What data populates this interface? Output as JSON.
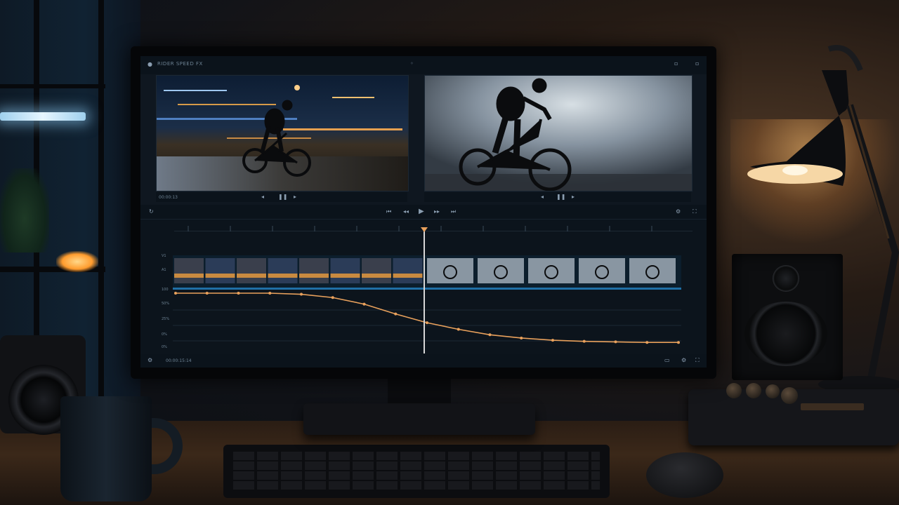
{
  "scene": {
    "type": "photo",
    "subject": "dark desk with monitor running a video editing application"
  },
  "app": {
    "title_text": "RIDER SPEED FX",
    "colors": {
      "accent_blue": "#1f6fa6",
      "curve": "#e9a15c",
      "playhead": "#d7d7d7",
      "ui_dark": "#0b131b"
    }
  },
  "viewers": {
    "left": {
      "timecode": "00:00:13"
    },
    "right": {
      "timecode": ""
    }
  },
  "timeline": {
    "track_labels": [
      "V1",
      "A1",
      "100",
      "50%",
      "25%",
      "0%",
      "0%"
    ],
    "status_text": "00:00:15:14",
    "speed_curve": {
      "points_pct": [
        100,
        100,
        100,
        100,
        98,
        92,
        80,
        62,
        46,
        34,
        24,
        18,
        14,
        12,
        11,
        10,
        10
      ]
    }
  },
  "icons": [
    "app-menu-icon",
    "play-icon",
    "pause-icon",
    "step-back-icon",
    "step-forward-icon",
    "loop-icon",
    "settings-icon",
    "zoom-icon",
    "fullscreen-icon"
  ]
}
